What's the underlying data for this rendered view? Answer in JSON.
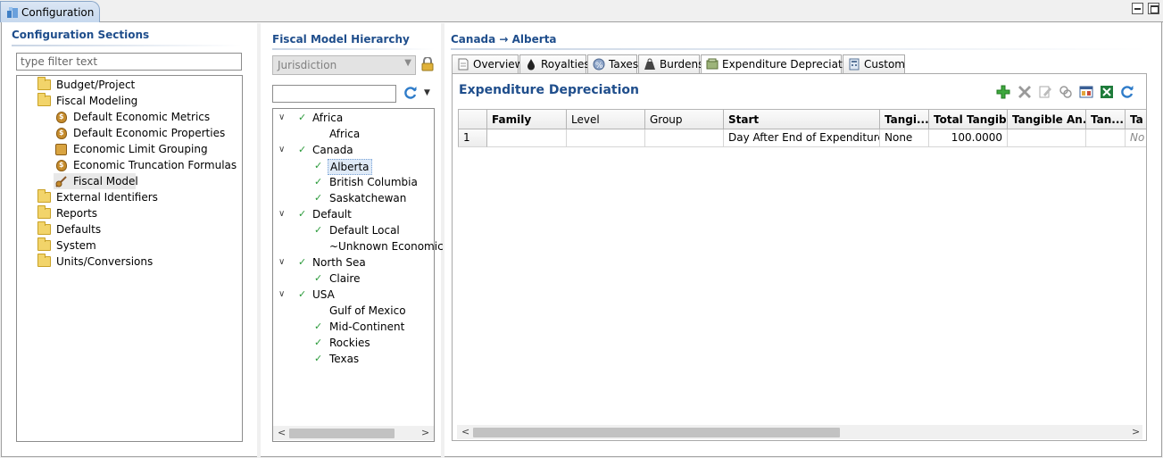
{
  "window": {
    "title": "Configuration"
  },
  "config_sections": {
    "title": "Configuration Sections",
    "filter_placeholder": "type filter text",
    "items": [
      {
        "label": "Budget/Project"
      },
      {
        "label": "Fiscal Modeling"
      },
      {
        "label": "Default Economic Metrics"
      },
      {
        "label": "Default Economic Properties"
      },
      {
        "label": "Economic Limit Grouping"
      },
      {
        "label": "Economic Truncation Formulas"
      },
      {
        "label": "Fiscal Model"
      },
      {
        "label": "External Identifiers"
      },
      {
        "label": "Reports"
      },
      {
        "label": "Defaults"
      },
      {
        "label": "System"
      },
      {
        "label": "Units/Conversions"
      }
    ]
  },
  "hierarchy": {
    "title": "Fiscal Model Hierarchy",
    "combo_value": "Jurisdiction",
    "search_value": "",
    "nodes": [
      {
        "label": "Africa",
        "checked": true
      },
      {
        "label": "Africa",
        "checked": false
      },
      {
        "label": "Canada",
        "checked": true
      },
      {
        "label": "Alberta",
        "checked": true
      },
      {
        "label": "British Columbia",
        "checked": true
      },
      {
        "label": "Saskatchewan",
        "checked": true
      },
      {
        "label": "Default",
        "checked": true
      },
      {
        "label": "Default Local",
        "checked": true
      },
      {
        "label": "~Unknown Economic",
        "checked": false
      },
      {
        "label": "North Sea",
        "checked": true
      },
      {
        "label": "Claire",
        "checked": true
      },
      {
        "label": "USA",
        "checked": true
      },
      {
        "label": "Gulf of Mexico",
        "checked": false
      },
      {
        "label": "Mid-Continent",
        "checked": true
      },
      {
        "label": "Rockies",
        "checked": true
      },
      {
        "label": "Texas",
        "checked": true
      }
    ]
  },
  "detail": {
    "breadcrumb": "Canada → Alberta",
    "tabs": [
      {
        "label": "Overview"
      },
      {
        "label": "Royalties"
      },
      {
        "label": "Taxes"
      },
      {
        "label": "Burdens"
      },
      {
        "label": "Expenditure Depreciation"
      },
      {
        "label": "Custom"
      }
    ],
    "active_tab": "Expenditure Depreciation",
    "section_title": "Expenditure Depreciation",
    "grid": {
      "columns": [
        "Family",
        "Level",
        "Group",
        "Start",
        "Tangi...",
        "Total Tangib...",
        "Tangible An...",
        "Tan...",
        "Ta"
      ],
      "rows": [
        {
          "num": "1",
          "cells": [
            "",
            "",
            "",
            "Day After End of Expenditure",
            "None",
            "100.0000",
            "",
            "",
            "No"
          ]
        }
      ]
    }
  },
  "colors": {
    "title_blue": "#1f4e8c",
    "check_green": "#2a9a3a",
    "add_green": "#3ea83e"
  }
}
